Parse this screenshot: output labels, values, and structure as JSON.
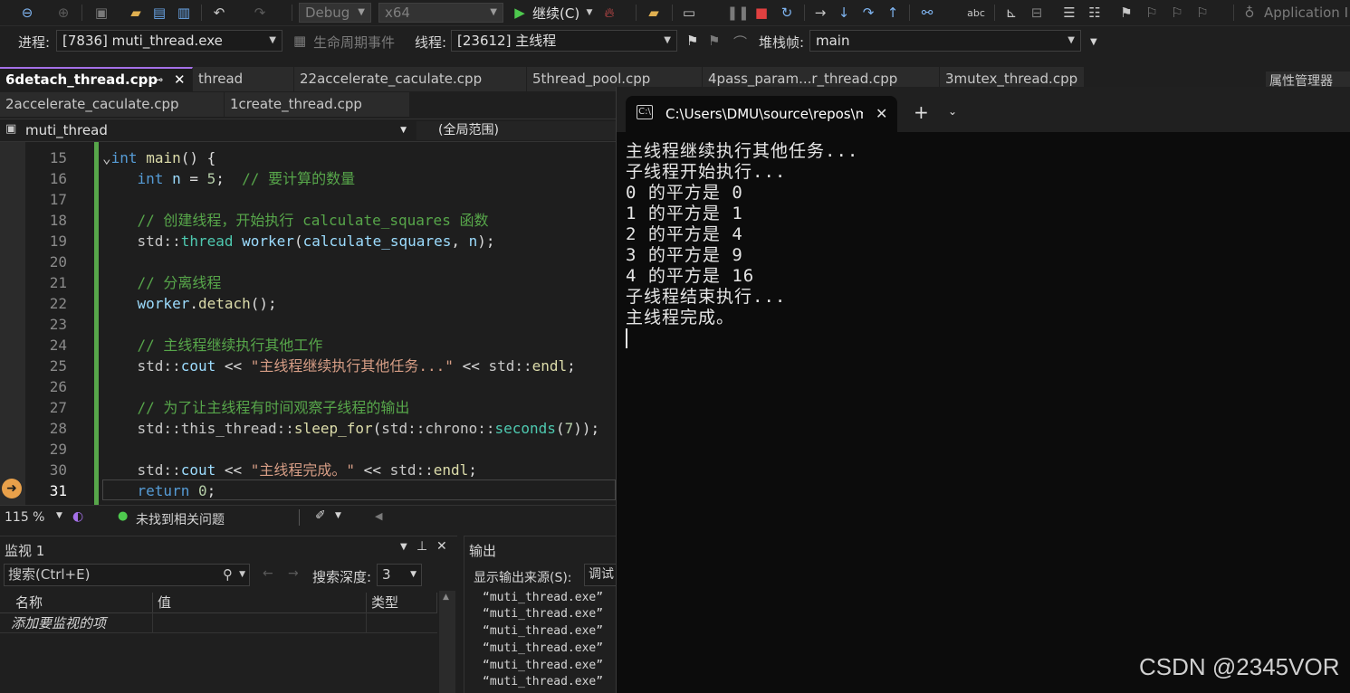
{
  "toolbar": {
    "config": "Debug",
    "platform": "x64",
    "continue_label": "继续(C)",
    "app_insights": "Application I"
  },
  "debugbar": {
    "process_label": "进程:",
    "process_value": "[7836] muti_thread.exe",
    "lifecycle_label": "生命周期事件",
    "thread_label": "线程:",
    "thread_value": "[23612] 主线程",
    "stackframe_label": "堆栈帧:",
    "stackframe_value": "main"
  },
  "tabs_row1": [
    "6detach_thread.cpp",
    "thread",
    "22accelerate_caculate.cpp",
    "5thread_pool.cpp",
    "4pass_param...r_thread.cpp",
    "3mutex_thread.cpp"
  ],
  "tabs_row2": [
    "2accelerate_caculate.cpp",
    "1create_thread.cpp"
  ],
  "property_manager_tab": "属性管理器",
  "navbar": {
    "project": "muti_thread",
    "scope": "(全局范围)"
  },
  "editor": {
    "line_numbers": [
      "15",
      "16",
      "17",
      "18",
      "19",
      "20",
      "21",
      "22",
      "23",
      "24",
      "25",
      "26",
      "27",
      "28",
      "29",
      "30",
      "31"
    ],
    "current_line": "31"
  },
  "edstatus": {
    "zoom": "115 %",
    "issues": "未找到相关问题"
  },
  "watch": {
    "title": "监视 1",
    "search_placeholder": "搜索(Ctrl+E)",
    "depth_label": "搜索深度:",
    "depth_value": "3",
    "col_name": "名称",
    "col_value": "值",
    "col_type": "类型",
    "add_item": "添加要监视的项"
  },
  "output": {
    "title": "输出",
    "source_label": "显示输出来源(S):",
    "source_value": "调试",
    "lines": [
      "“muti_thread.exe”",
      "“muti_thread.exe”",
      "“muti_thread.exe”",
      "“muti_thread.exe”",
      "“muti_thread.exe”",
      "“muti_thread.exe”"
    ]
  },
  "terminal": {
    "tab_title": "C:\\Users\\DMU\\source\\repos\\m",
    "lines": [
      "主线程继续执行其他任务...",
      "子线程开始执行...",
      "0 的平方是 0",
      "1 的平方是 1",
      "2 的平方是 4",
      "3 的平方是 9",
      "4 的平方是 16",
      "子线程结束执行...",
      "主线程完成。"
    ]
  },
  "watermark": "CSDN @2345VOR"
}
